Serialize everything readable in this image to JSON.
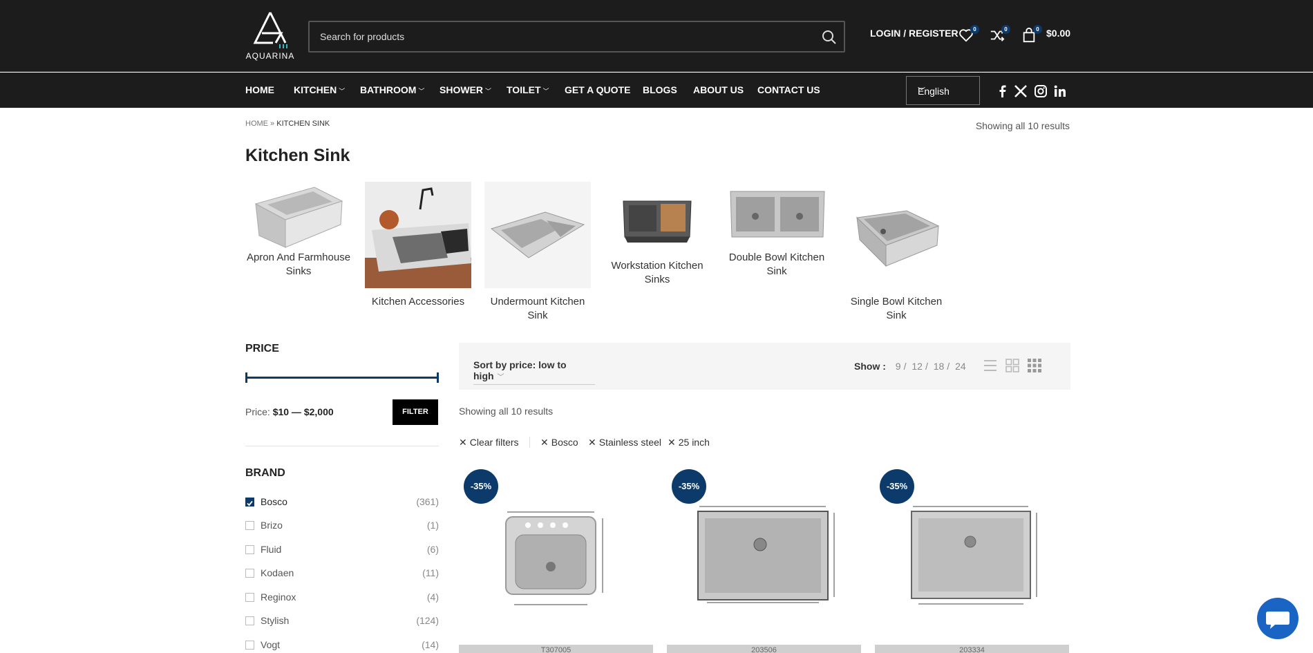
{
  "header": {
    "logo_text": "AQUARINA",
    "search_placeholder": "Search for products",
    "login_label": "LOGIN / REGISTER",
    "wishlist_count": "0",
    "compare_count": "0",
    "cart_count": "0",
    "cart_total": "$0.00"
  },
  "nav": {
    "items": [
      "HOME",
      "KITCHEN",
      "BATHROOM",
      "SHOWER",
      "TOILET",
      "GET A QUOTE",
      "BLOGS",
      "ABOUT US",
      "CONTACT US"
    ],
    "language": "English"
  },
  "breadcrumb": {
    "home": "HOME",
    "sep": " » ",
    "current": "KITCHEN SINK"
  },
  "results_text": "Showing all 10 results",
  "page_title": "Kitchen Sink",
  "categories": [
    "Apron And Farmhouse Sinks",
    "Kitchen Accessories",
    "Undermount Kitchen Sink",
    "Workstation Kitchen Sinks",
    "Double Bowl Kitchen Sink",
    "Single Bowl Kitchen Sink"
  ],
  "sidebar": {
    "price_heading": "PRICE",
    "price_label": "Price:",
    "price_range": "$10 — $2,000",
    "filter_label": "FILTER",
    "brand_heading": "BRAND",
    "brands": [
      {
        "name": "Bosco",
        "count": "(361)",
        "checked": true
      },
      {
        "name": "Brizo",
        "count": "(1)",
        "checked": false
      },
      {
        "name": "Fluid",
        "count": "(6)",
        "checked": false
      },
      {
        "name": "Kodaen",
        "count": "(11)",
        "checked": false
      },
      {
        "name": "Reginox",
        "count": "(4)",
        "checked": false
      },
      {
        "name": "Stylish",
        "count": "(124)",
        "checked": false
      },
      {
        "name": "Vogt",
        "count": "(14)",
        "checked": false
      }
    ]
  },
  "toolbar": {
    "sort_label": "Sort by price: low to high",
    "show_label": "Show :",
    "show_options": [
      "9",
      "12",
      "18",
      "24"
    ]
  },
  "filters": {
    "clear": "Clear filters",
    "active": [
      "Bosco",
      "Stainless steel",
      "25 inch"
    ]
  },
  "products": [
    {
      "discount": "-35%",
      "sku": "T307005"
    },
    {
      "discount": "-35%",
      "sku": "203506"
    },
    {
      "discount": "-35%",
      "sku": "203334"
    }
  ]
}
